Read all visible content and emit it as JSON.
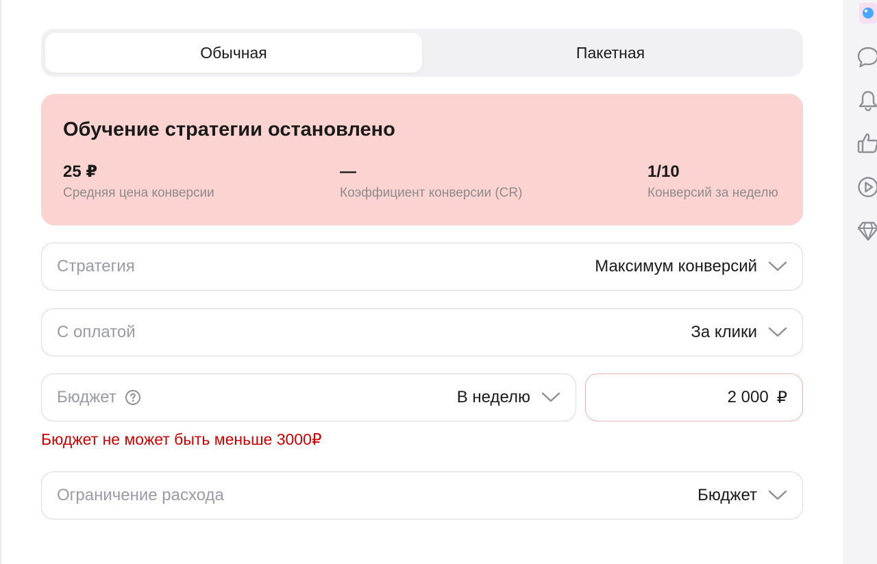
{
  "tabs": {
    "regular": "Обычная",
    "package": "Пакетная"
  },
  "alert": {
    "title": "Обучение стратегии остановлено",
    "metrics": [
      {
        "value": "25 ₽",
        "label": "Средняя цена конверсии"
      },
      {
        "value": "—",
        "label": "Коэффициент конверсии (CR)"
      },
      {
        "value": "1/10",
        "label": "Конверсий за неделю"
      }
    ]
  },
  "form": {
    "strategy": {
      "label": "Стратегия",
      "value": "Максимум конверсий"
    },
    "payment": {
      "label": "С оплатой",
      "value": "За клики"
    },
    "budget": {
      "label": "Бюджет",
      "period": "В неделю",
      "amount": "2 000",
      "currency": "₽"
    },
    "budget_error": "Бюджет не может быть меньше 3000₽",
    "limit": {
      "label": "Ограничение расхода",
      "value": "Бюджет"
    }
  },
  "colors": {
    "alert_bg": "#fbd3d1",
    "error": "#d10000",
    "tabs_bg": "#f1f1f4"
  },
  "icons": {
    "rail": [
      "app-logo-icon",
      "chat-icon",
      "bell-icon",
      "like-icon",
      "play-icon",
      "diamond-icon"
    ]
  }
}
